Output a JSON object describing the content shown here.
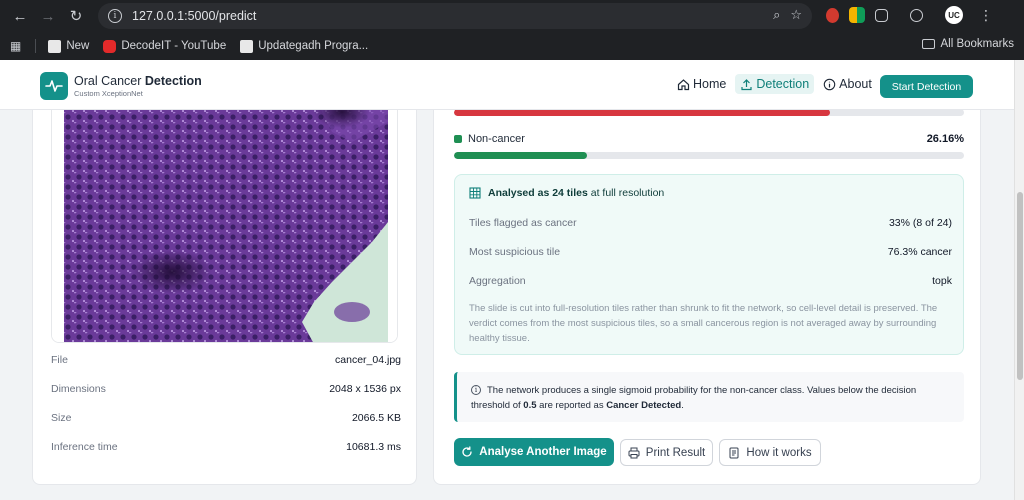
{
  "browser": {
    "url": "127.0.0.1:5000/predict",
    "bookmarks": [
      {
        "label": "New",
        "color": "#e8e8e8"
      },
      {
        "label": "DecodeIT - YouTube",
        "color": "#e32a2a"
      },
      {
        "label": "Updategadh Progra...",
        "color": "#e8e8e8"
      }
    ],
    "all_bookmarks": "All Bookmarks",
    "avatar": "UC"
  },
  "header": {
    "brand_pre": "Oral Cancer ",
    "brand_bold": "Detection",
    "brand_sub": "Custom XceptionNet",
    "nav": [
      "Home",
      "Detection",
      "About"
    ],
    "cta": "Start Detection"
  },
  "file_info": [
    {
      "key": "File",
      "value": "cancer_04.jpg"
    },
    {
      "key": "Dimensions",
      "value": "2048 x 1536 px"
    },
    {
      "key": "Size",
      "value": "2066.5 KB"
    },
    {
      "key": "Inference time",
      "value": "10681.3 ms"
    }
  ],
  "probabilities": {
    "cancer_fill": 0.738,
    "cancer_color": "#d7373f",
    "noncancer_label": "Non-cancer",
    "noncancer_pct": "26.16%",
    "noncancer_fill": 0.2616,
    "noncancer_color": "#1f8f53"
  },
  "tiles": {
    "head_bold": "Analysed as 24 tiles",
    "head_rest": " at full resolution",
    "rows": [
      {
        "key": "Tiles flagged as cancer",
        "value": "33% (8 of 24)"
      },
      {
        "key": "Most suspicious tile",
        "value": "76.3% cancer"
      },
      {
        "key": "Aggregation",
        "value": "topk"
      }
    ],
    "description": "The slide is cut into full-resolution tiles rather than shrunk to fit the network, so cell-level detail is preserved. The verdict comes from the most suspicious tiles, so a small cancerous region is not averaged away by surrounding healthy tissue."
  },
  "note": {
    "part1": "The network produces a single sigmoid probability for the non-cancer class. Values below the decision threshold of ",
    "threshold": "0.5",
    "part2": " are reported as ",
    "verdict": "Cancer Detected",
    "part3": "."
  },
  "actions": {
    "analyse": "Analyse Another Image",
    "print": "Print Result",
    "how": "How it works"
  },
  "colors": {
    "accent": "#14918a"
  }
}
